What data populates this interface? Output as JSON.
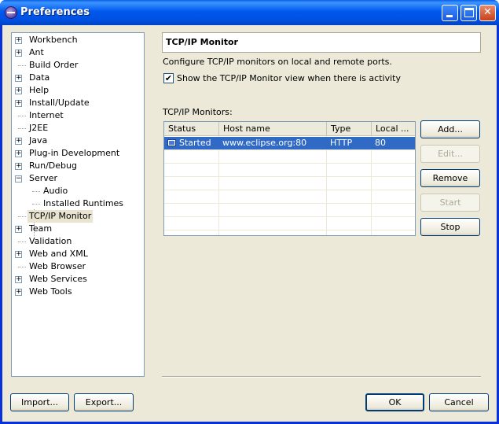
{
  "window": {
    "title": "Preferences",
    "icon": "eclipse-icon",
    "controls": [
      "minimize",
      "maximize",
      "close"
    ]
  },
  "tree": {
    "items": [
      {
        "label": "Workbench",
        "expandable": true
      },
      {
        "label": "Ant",
        "expandable": true
      },
      {
        "label": "Build Order",
        "expandable": false
      },
      {
        "label": "Data",
        "expandable": true
      },
      {
        "label": "Help",
        "expandable": true
      },
      {
        "label": "Install/Update",
        "expandable": true
      },
      {
        "label": "Internet",
        "expandable": false
      },
      {
        "label": "J2EE",
        "expandable": false
      },
      {
        "label": "Java",
        "expandable": true
      },
      {
        "label": "Plug-in Development",
        "expandable": true
      },
      {
        "label": "Run/Debug",
        "expandable": true
      },
      {
        "label": "Server",
        "expandable": true,
        "expanded": true
      },
      {
        "label": "Audio",
        "expandable": false,
        "child": true
      },
      {
        "label": "Installed Runtimes",
        "expandable": false,
        "child": true
      },
      {
        "label": "TCP/IP Monitor",
        "expandable": false,
        "selected": true
      },
      {
        "label": "Team",
        "expandable": true
      },
      {
        "label": "Validation",
        "expandable": false
      },
      {
        "label": "Web and XML",
        "expandable": true
      },
      {
        "label": "Web Browser",
        "expandable": false
      },
      {
        "label": "Web Services",
        "expandable": true
      },
      {
        "label": "Web Tools",
        "expandable": true
      }
    ]
  },
  "page": {
    "title": "TCP/IP Monitor",
    "description": "Configure TCP/IP monitors on local and remote ports.",
    "show_view_checkbox": {
      "label": "Show the TCP/IP Monitor view when there is activity",
      "checked": true
    },
    "monitors_label": "TCP/IP Monitors:",
    "table": {
      "columns": [
        "Status",
        "Host name",
        "Type",
        "Local ..."
      ],
      "rows": [
        {
          "status": "Started",
          "host": "www.eclipse.org:80",
          "type": "HTTP",
          "local": "80",
          "selected": true
        }
      ]
    },
    "buttons": {
      "add": "Add...",
      "edit": "Edit...",
      "remove": "Remove",
      "start": "Start",
      "stop": "Stop"
    }
  },
  "footer": {
    "import": "Import...",
    "export": "Export...",
    "ok": "OK",
    "cancel": "Cancel"
  },
  "colors": {
    "titlebar": "#0058ee",
    "dialog_bg": "#ece9d8",
    "selection": "#316ac5"
  }
}
